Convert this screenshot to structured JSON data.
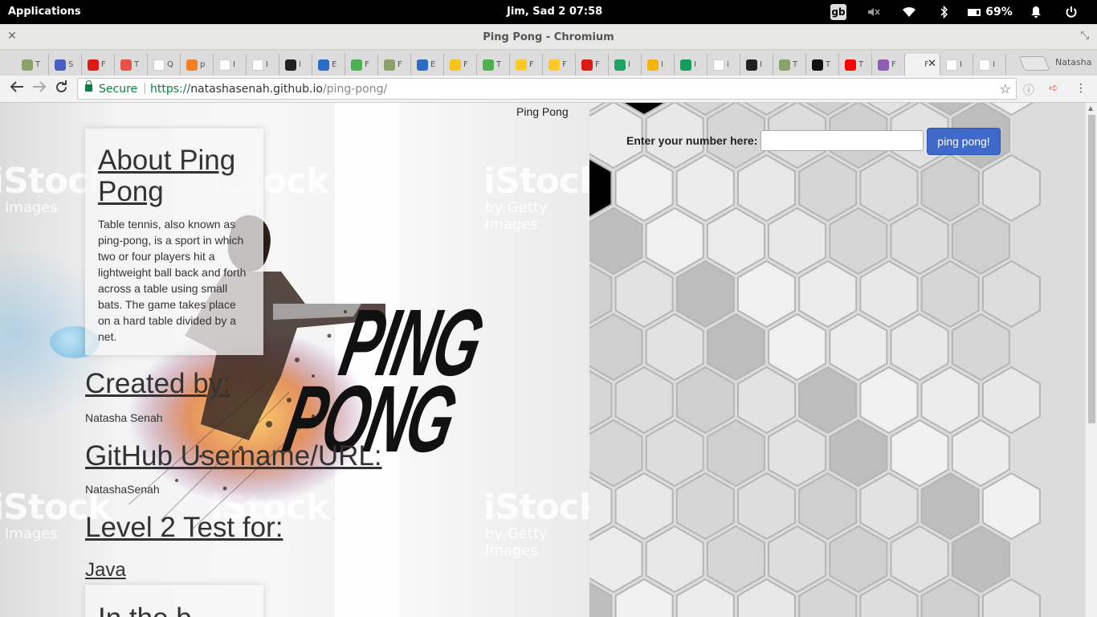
{
  "system_bar": {
    "applications": "Applications",
    "clock": "Jim, Sad  2    07:58",
    "keyboard_layout": "gb",
    "battery": "69%"
  },
  "window": {
    "title": "Ping Pong - Chromium"
  },
  "tabs": [
    {
      "icon": "tree-favicon",
      "label": "T",
      "color": "#8ba36a"
    },
    {
      "icon": "doc-favicon",
      "label": "S",
      "color": "#4a5fc1"
    },
    {
      "icon": "angular-favicon",
      "label": "F",
      "color": "#dd1b16"
    },
    {
      "icon": "swirl-favicon",
      "label": "T",
      "color": "#e8524a"
    },
    {
      "icon": "q-favicon",
      "label": "Q",
      "color": "#ffffff",
      "text_color": "#b92b27"
    },
    {
      "icon": "stackoverflow-favicon",
      "label": "p",
      "color": "#f48024"
    },
    {
      "icon": "gmail-favicon",
      "label": "I",
      "color": "#ffffff",
      "text_color": "#d93025"
    },
    {
      "icon": "gmail-favicon",
      "label": "I",
      "color": "#ffffff",
      "text_color": "#d93025"
    },
    {
      "icon": "github-favicon",
      "label": "I",
      "color": "#222222"
    },
    {
      "icon": "bootstrap-favicon",
      "label": "E",
      "color": "#2b6cc4"
    },
    {
      "icon": "w3-favicon",
      "label": "F",
      "color": "#4caf50"
    },
    {
      "icon": "tree-favicon",
      "label": "F",
      "color": "#8ba36a"
    },
    {
      "icon": "bootstrap-favicon",
      "label": "E",
      "color": "#2b6cc4"
    },
    {
      "icon": "python-favicon",
      "label": "F",
      "color": "#f5c518"
    },
    {
      "icon": "w3-favicon",
      "label": "T",
      "color": "#4caf50"
    },
    {
      "icon": "firebase-favicon",
      "label": "F",
      "color": "#ffca28"
    },
    {
      "icon": "firebase-favicon",
      "label": "F",
      "color": "#ffca28"
    },
    {
      "icon": "angular-favicon",
      "label": "F",
      "color": "#dd1b16"
    },
    {
      "icon": "gdrive-favicon",
      "label": "I",
      "color": "#1fa463"
    },
    {
      "icon": "slides-favicon",
      "label": "I",
      "color": "#f4b400"
    },
    {
      "icon": "sheets-favicon",
      "label": "I",
      "color": "#0f9d58"
    },
    {
      "icon": "google-favicon",
      "label": "i",
      "color": "#ffffff",
      "text_color": "#4285f4"
    },
    {
      "icon": "camera-favicon",
      "label": "I",
      "color": "#222222"
    },
    {
      "icon": "tree-favicon",
      "label": "T",
      "color": "#8ba36a"
    },
    {
      "icon": "medium-favicon",
      "label": "T",
      "color": "#111111"
    },
    {
      "icon": "youtube-favicon",
      "label": "T",
      "color": "#ff0000"
    },
    {
      "icon": "h-favicon",
      "label": "F",
      "color": "#8e5bb5"
    },
    {
      "icon": "blank-favicon",
      "label": "F",
      "color": "#f2f2f2",
      "active": true
    },
    {
      "icon": "google-favicon",
      "label": "I",
      "color": "#ffffff",
      "text_color": "#4285f4"
    },
    {
      "icon": "page-favicon",
      "label": "I",
      "color": "#ffffff",
      "text_color": "#777777"
    }
  ],
  "profile_name": "Natasha",
  "address_bar": {
    "secure_label": "Secure",
    "scheme": "https://",
    "host": "natashasenah.github.io",
    "path": "/ping-pong/"
  },
  "page": {
    "heading": "Ping Pong",
    "about_title": "About Ping Pong",
    "about_text": "Table tennis, also known as ping-pong, is a sport in which two or four players hit a lightweight ball back and forth across a table using small bats. The game takes place on a hard table divided by a net.",
    "created_by_title": "Created by:",
    "created_by_value": "Natasha Senah",
    "github_title": "GitHub Username/URL:",
    "github_value": "NatashaSenah",
    "level_title": "Level 2 Test for:",
    "level_value": "Java",
    "partial_heading": "In the b",
    "background_logo_top": "PING",
    "background_logo_bottom": "PONG",
    "watermark": "iStock",
    "watermark_sub": "by Getty Images",
    "watermark_images": "Images",
    "form_label": "Enter your number here:",
    "input_value": "",
    "button_label": "ping pong!"
  }
}
